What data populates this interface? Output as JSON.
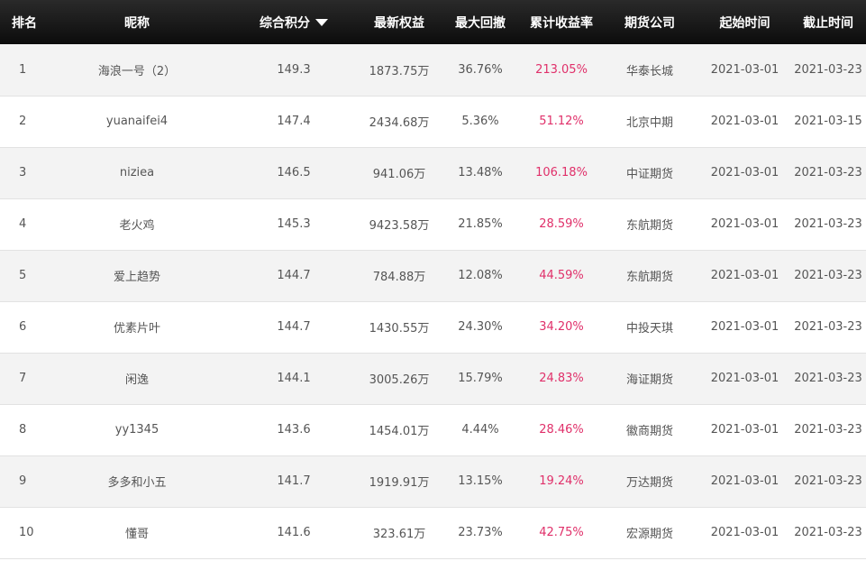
{
  "headers": {
    "rank": "排名",
    "nickname": "昵称",
    "score": "综合积分",
    "equity": "最新权益",
    "drawdown": "最大回撤",
    "return_rate": "累计收益率",
    "broker": "期货公司",
    "start": "起始时间",
    "end": "截止时间"
  },
  "sort": {
    "column": "score",
    "direction": "desc",
    "icon": "caret-down-icon"
  },
  "colors": {
    "header_bg": "#111111",
    "rate": "#e0306a",
    "row_alt": "#f3f3f3",
    "text": "#555555"
  },
  "rows": [
    {
      "rank": "1",
      "nickname": "海浪一号（2）",
      "score": "149.3",
      "equity": "1873.75万",
      "drawdown": "36.76%",
      "return_rate": "213.05%",
      "broker": "华泰长城",
      "start": "2021-03-01",
      "end": "2021-03-23"
    },
    {
      "rank": "2",
      "nickname": "yuanaifei4",
      "score": "147.4",
      "equity": "2434.68万",
      "drawdown": "5.36%",
      "return_rate": "51.12%",
      "broker": "北京中期",
      "start": "2021-03-01",
      "end": "2021-03-15"
    },
    {
      "rank": "3",
      "nickname": "niziea",
      "score": "146.5",
      "equity": "941.06万",
      "drawdown": "13.48%",
      "return_rate": "106.18%",
      "broker": "中证期货",
      "start": "2021-03-01",
      "end": "2021-03-23"
    },
    {
      "rank": "4",
      "nickname": "老火鸡",
      "score": "145.3",
      "equity": "9423.58万",
      "drawdown": "21.85%",
      "return_rate": "28.59%",
      "broker": "东航期货",
      "start": "2021-03-01",
      "end": "2021-03-23"
    },
    {
      "rank": "5",
      "nickname": "爱上趋势",
      "score": "144.7",
      "equity": "784.88万",
      "drawdown": "12.08%",
      "return_rate": "44.59%",
      "broker": "东航期货",
      "start": "2021-03-01",
      "end": "2021-03-23"
    },
    {
      "rank": "6",
      "nickname": "优素片叶",
      "score": "144.7",
      "equity": "1430.55万",
      "drawdown": "24.30%",
      "return_rate": "34.20%",
      "broker": "中投天琪",
      "start": "2021-03-01",
      "end": "2021-03-23"
    },
    {
      "rank": "7",
      "nickname": "闲逸",
      "score": "144.1",
      "equity": "3005.26万",
      "drawdown": "15.79%",
      "return_rate": "24.83%",
      "broker": "海证期货",
      "start": "2021-03-01",
      "end": "2021-03-23"
    },
    {
      "rank": "8",
      "nickname": "yy1345",
      "score": "143.6",
      "equity": "1454.01万",
      "drawdown": "4.44%",
      "return_rate": "28.46%",
      "broker": "徽商期货",
      "start": "2021-03-01",
      "end": "2021-03-23"
    },
    {
      "rank": "9",
      "nickname": "多多和小五",
      "score": "141.7",
      "equity": "1919.91万",
      "drawdown": "13.15%",
      "return_rate": "19.24%",
      "broker": "万达期货",
      "start": "2021-03-01",
      "end": "2021-03-23"
    },
    {
      "rank": "10",
      "nickname": "懂哥",
      "score": "141.6",
      "equity": "323.61万",
      "drawdown": "23.73%",
      "return_rate": "42.75%",
      "broker": "宏源期货",
      "start": "2021-03-01",
      "end": "2021-03-23"
    }
  ]
}
